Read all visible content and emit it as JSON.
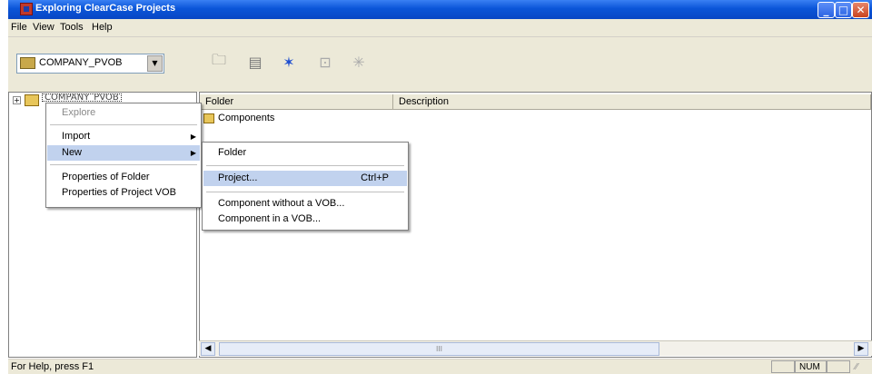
{
  "window": {
    "title": "Exploring ClearCase Projects"
  },
  "menu": [
    "File",
    "View",
    "Tools",
    "Help"
  ],
  "toolbar": {
    "vob_selector": "COMPANY_PVOB",
    "icons": [
      "folder-icon",
      "properties-icon",
      "new-project-icon",
      "deliver-icon",
      "rebase-icon"
    ]
  },
  "tree": {
    "root_label": "COMPANY_PVOB"
  },
  "list": {
    "columns": [
      "Folder",
      "Description"
    ],
    "rows": [
      {
        "name": "Components",
        "description": ""
      }
    ]
  },
  "context_menu": {
    "items": [
      {
        "label": "Explore",
        "disabled": true
      },
      {
        "label": "Import",
        "submenu": true
      },
      {
        "label": "New",
        "submenu": true,
        "selected": true
      },
      {
        "label": "Properties of Folder"
      },
      {
        "label": "Properties of Project VOB"
      }
    ]
  },
  "submenu": {
    "items": [
      {
        "label": "Folder"
      },
      {
        "label": "Project...",
        "shortcut": "Ctrl+P",
        "selected": true
      },
      {
        "label": "Component without a VOB..."
      },
      {
        "label": "Component in a VOB..."
      }
    ]
  },
  "scrollbar": {
    "thumb_grip": "III"
  },
  "status": {
    "text": "For Help, press F1",
    "num": "NUM"
  }
}
